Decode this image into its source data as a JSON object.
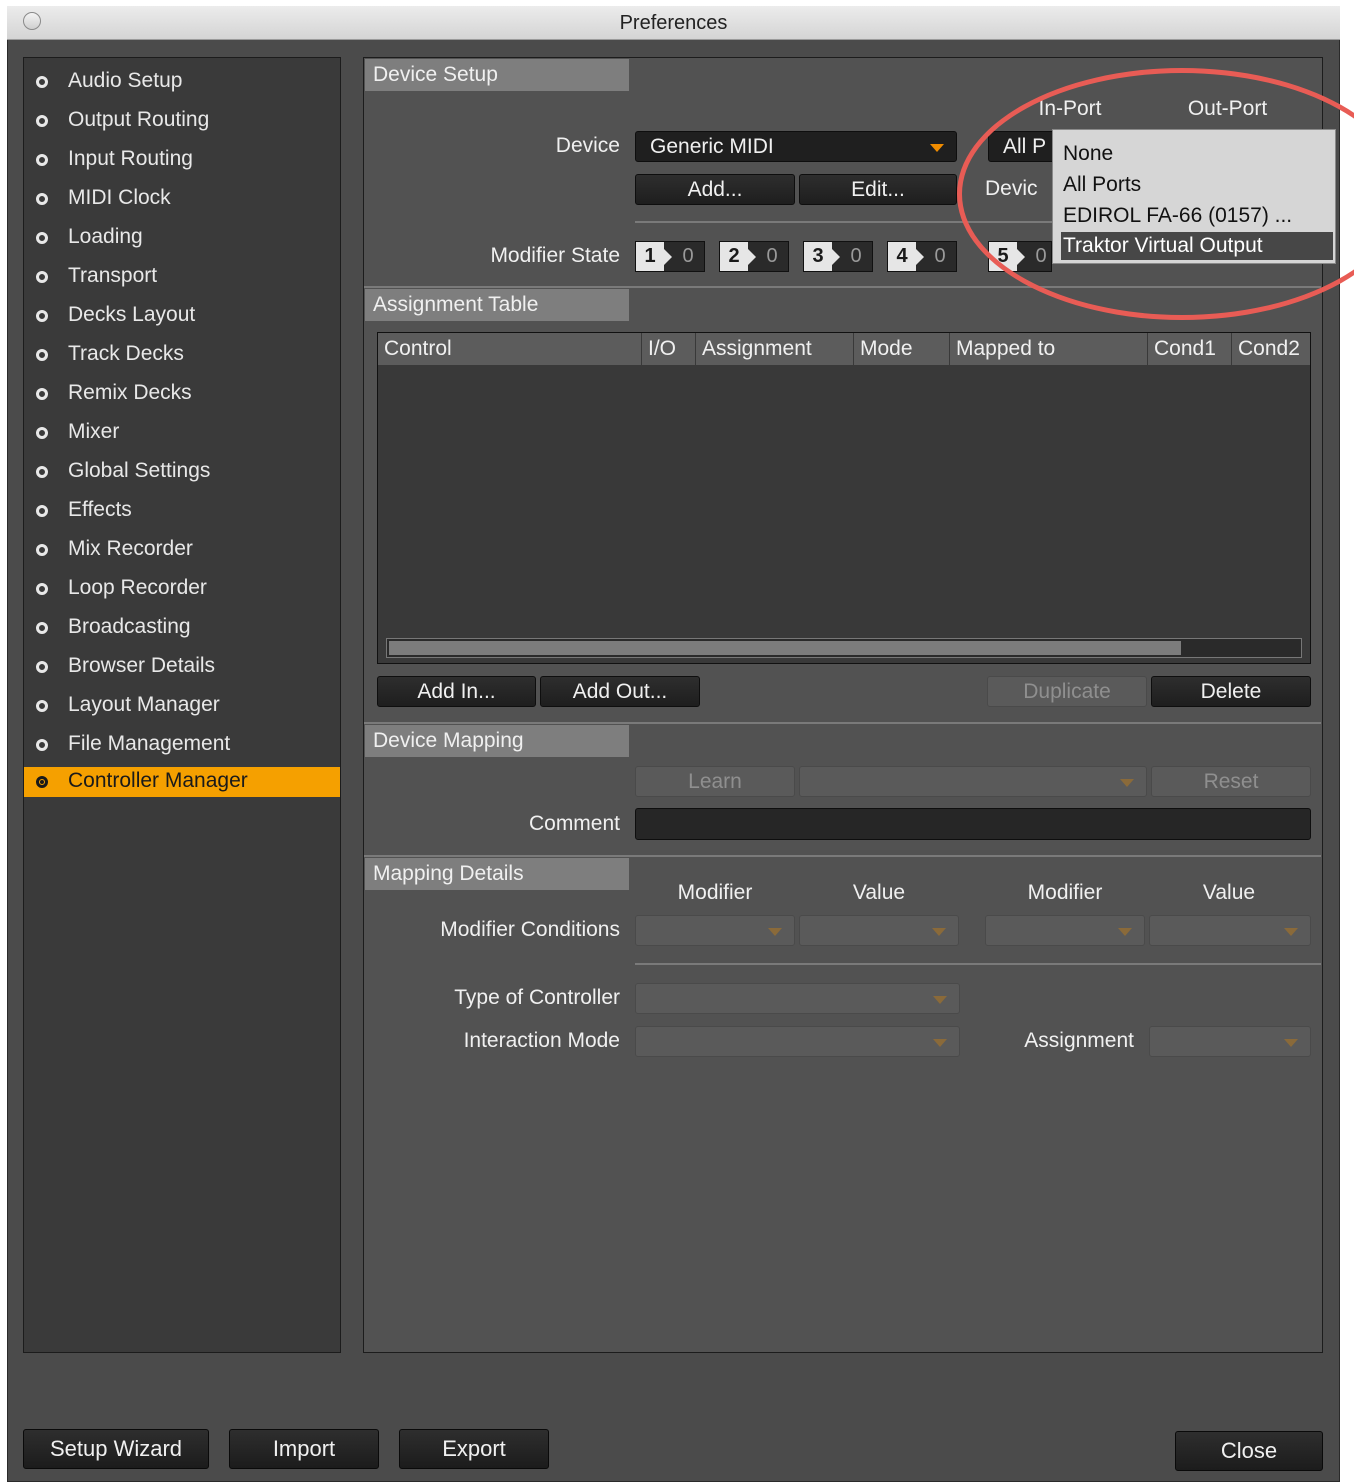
{
  "window": {
    "title": "Preferences"
  },
  "sidebar": {
    "items": [
      {
        "label": "Audio Setup"
      },
      {
        "label": "Output Routing"
      },
      {
        "label": "Input Routing"
      },
      {
        "label": "MIDI Clock"
      },
      {
        "label": "Loading"
      },
      {
        "label": "Transport"
      },
      {
        "label": "Decks Layout"
      },
      {
        "label": "Track Decks"
      },
      {
        "label": "Remix Decks"
      },
      {
        "label": "Mixer"
      },
      {
        "label": "Global Settings"
      },
      {
        "label": "Effects"
      },
      {
        "label": "Mix Recorder"
      },
      {
        "label": "Loop Recorder"
      },
      {
        "label": "Broadcasting"
      },
      {
        "label": "Browser Details"
      },
      {
        "label": "Layout Manager"
      },
      {
        "label": "File Management"
      },
      {
        "label": "Controller Manager",
        "active": true
      }
    ]
  },
  "device_setup": {
    "header": "Device Setup",
    "in_port_label": "In-Port",
    "out_port_label": "Out-Port",
    "device_label": "Device",
    "device_value": "Generic MIDI",
    "in_port_value": "All P",
    "device_truncated_label": "Devic",
    "add_button": "Add...",
    "edit_button": "Edit...",
    "modifier_state_label": "Modifier State",
    "modifiers": [
      {
        "n": "1",
        "v": "0"
      },
      {
        "n": "2",
        "v": "0"
      },
      {
        "n": "3",
        "v": "0"
      },
      {
        "n": "4",
        "v": "0"
      },
      {
        "n": "5",
        "v": "0"
      }
    ]
  },
  "port_dropdown": {
    "options": [
      {
        "label": "None"
      },
      {
        "label": "All Ports"
      },
      {
        "label": "EDIROL FA-66 (0157) ..."
      },
      {
        "label": "Traktor Virtual Output",
        "selected": true
      }
    ],
    "highlight_color": "#e85c55"
  },
  "assignment_table": {
    "header": "Assignment Table",
    "columns": [
      "Control",
      "I/O",
      "Assignment",
      "Mode",
      "Mapped to",
      "Cond1",
      "Cond2"
    ],
    "add_in_button": "Add In...",
    "add_out_button": "Add Out...",
    "duplicate_button": "Duplicate",
    "delete_button": "Delete"
  },
  "device_mapping": {
    "header": "Device Mapping",
    "learn_button": "Learn",
    "reset_button": "Reset",
    "comment_label": "Comment",
    "comment_value": ""
  },
  "mapping_details": {
    "header": "Mapping Details",
    "modifier_label_1": "Modifier",
    "value_label_1": "Value",
    "modifier_label_2": "Modifier",
    "value_label_2": "Value",
    "modifier_conditions_label": "Modifier Conditions",
    "type_of_controller_label": "Type of Controller",
    "interaction_mode_label": "Interaction Mode",
    "assignment_label": "Assignment"
  },
  "footer": {
    "setup_wizard": "Setup Wizard",
    "import": "Import",
    "export": "Export",
    "close": "Close"
  },
  "colors": {
    "accent": "#f5a000",
    "dropdown_arrow": "#f08c00",
    "panel_bg": "#525252",
    "sidebar_bg": "#3a3a3a"
  }
}
